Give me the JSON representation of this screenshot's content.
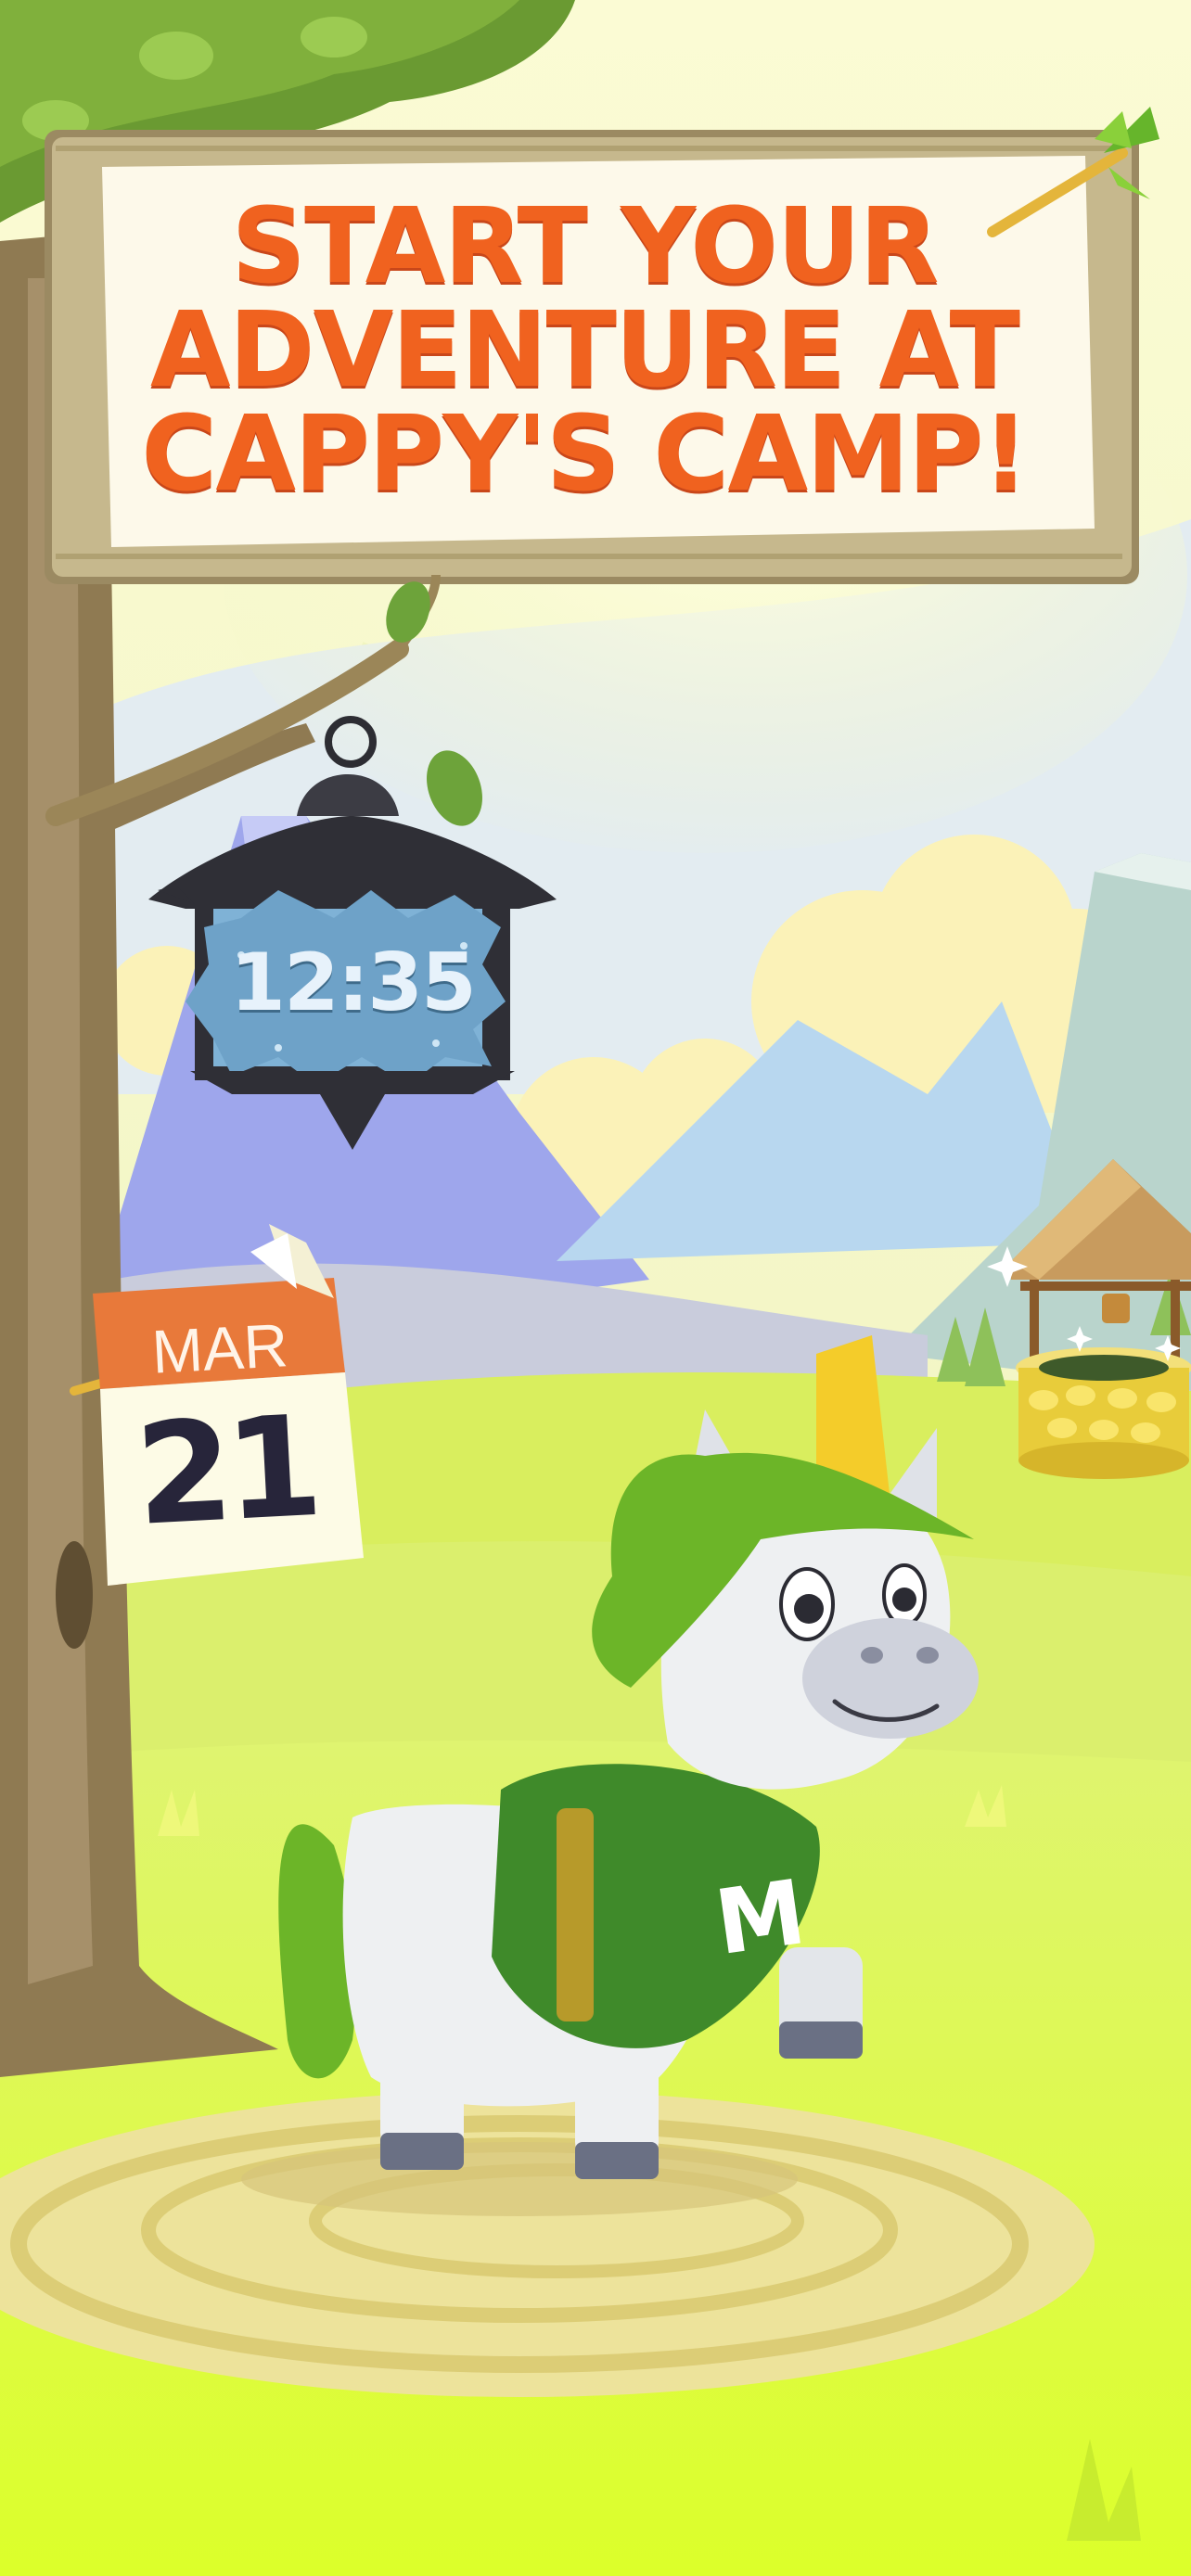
{
  "sign": {
    "lines": [
      "START YOUR",
      "ADVENTURE AT",
      "CAPPY'S CAMP!"
    ]
  },
  "lantern": {
    "time": "12:35"
  },
  "calendar": {
    "month": "MAR",
    "day": "21"
  },
  "mascot": {
    "shirt_letter": "M"
  },
  "colors": {
    "sign_text": "#f0621f",
    "sky": "#f6f8c8",
    "grass": "#d6f23a",
    "lantern_face": "#7fb2d6",
    "calendar_header": "#e8793a"
  },
  "icons": [
    "tree",
    "wooden-sign",
    "leaf-arrow",
    "lantern-clock",
    "calendar-page",
    "mountain",
    "wishing-well",
    "unicorn-mascot"
  ]
}
